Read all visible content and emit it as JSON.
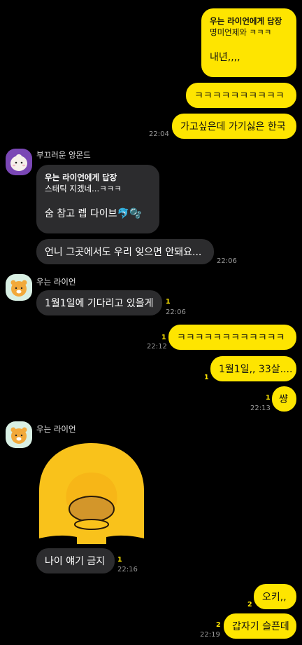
{
  "messages": {
    "m1": {
      "reply_title": "우는 라이언에게 답장",
      "reply_quote": "명미언제와 ㅋㅋㅋ",
      "text": "내년,,,,"
    },
    "m2": {
      "text": "ㅋㅋㅋㅋㅋㅋㅋㅋㅋㅋ"
    },
    "m3": {
      "text": "가고싶은데 가기싫은 한국",
      "time": "22:04"
    },
    "s1": {
      "sender": "부끄러운 앙몬드"
    },
    "m4": {
      "reply_title": "우는 라이언에게 답장",
      "reply_quote": "스태틱 지겠네...ㅋㅋㅋ",
      "text": "숨 참고 렙 다이브🐬🫧"
    },
    "m5": {
      "text": "언니 그곳에서도 우리 잊으면 안돼요...",
      "time": "22:06"
    },
    "s2": {
      "sender": "우는 라이언"
    },
    "m6": {
      "text": "1월1일에 기다리고 있을게",
      "unread": "1",
      "time": "22:06"
    },
    "m7": {
      "text": "ㅋㅋㅋㅋㅋㅋㅋㅋㅋㅋㅋㅋ",
      "unread": "1",
      "time": "22:12"
    },
    "m8": {
      "text": "1월1일,, 33살....",
      "unread": "1"
    },
    "m9": {
      "text": "썅",
      "unread": "1",
      "time": "22:13"
    },
    "s3": {
      "sender": "우는 라이언"
    },
    "m10": {
      "text": "나이 얘기 금지",
      "unread": "1",
      "time": "22:16"
    },
    "m11": {
      "text": "오키,,",
      "unread": "2"
    },
    "m12": {
      "text": "갑자기 슬픈데",
      "unread": "2",
      "time": "22:19"
    }
  },
  "colors": {
    "my_bubble": "#fee500",
    "their_bubble": "#2c2c2e",
    "unread": "#fee500",
    "background": "#000000"
  },
  "icons": {
    "avatar_almond": "almond-character-avatar",
    "avatar_ryan": "crying-ryan-avatar",
    "sticker": "yellow-face-sticker"
  }
}
